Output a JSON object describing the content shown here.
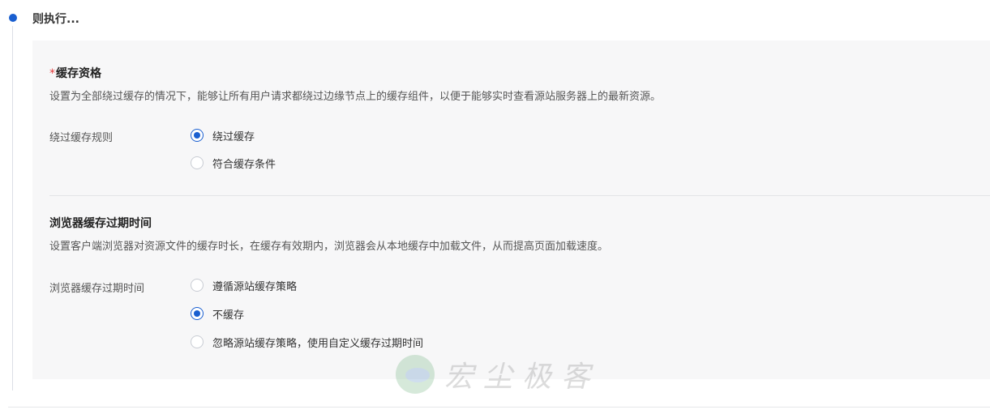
{
  "step": {
    "title": "则执行..."
  },
  "cache_eligibility": {
    "required_mark": "*",
    "title": "缓存资格",
    "description": "设置为全部绕过缓存的情况下，能够让所有用户请求都绕过边缘节点上的缓存组件，以便于能够实时查看源站服务器上的最新资源。",
    "field_label": "绕过缓存规则",
    "options": [
      {
        "label": "绕过缓存",
        "checked": true
      },
      {
        "label": "符合缓存条件",
        "checked": false
      }
    ]
  },
  "browser_cache": {
    "title": "浏览器缓存过期时间",
    "description": "设置客户端浏览器对资源文件的缓存时长，在缓存有效期内，浏览器会从本地缓存中加载文件，从而提高页面加载速度。",
    "field_label": "浏览器缓存过期时间",
    "options": [
      {
        "label": "遵循源站缓存策略",
        "checked": false
      },
      {
        "label": "不缓存",
        "checked": true
      },
      {
        "label": "忽略源站缓存策略，使用自定义缓存过期时间",
        "checked": false
      }
    ]
  },
  "watermark": {
    "text": "宏尘极客"
  },
  "colors": {
    "accent": "#1a5fd0",
    "required": "#e23c3c",
    "panel_bg": "#f7f7f8"
  }
}
